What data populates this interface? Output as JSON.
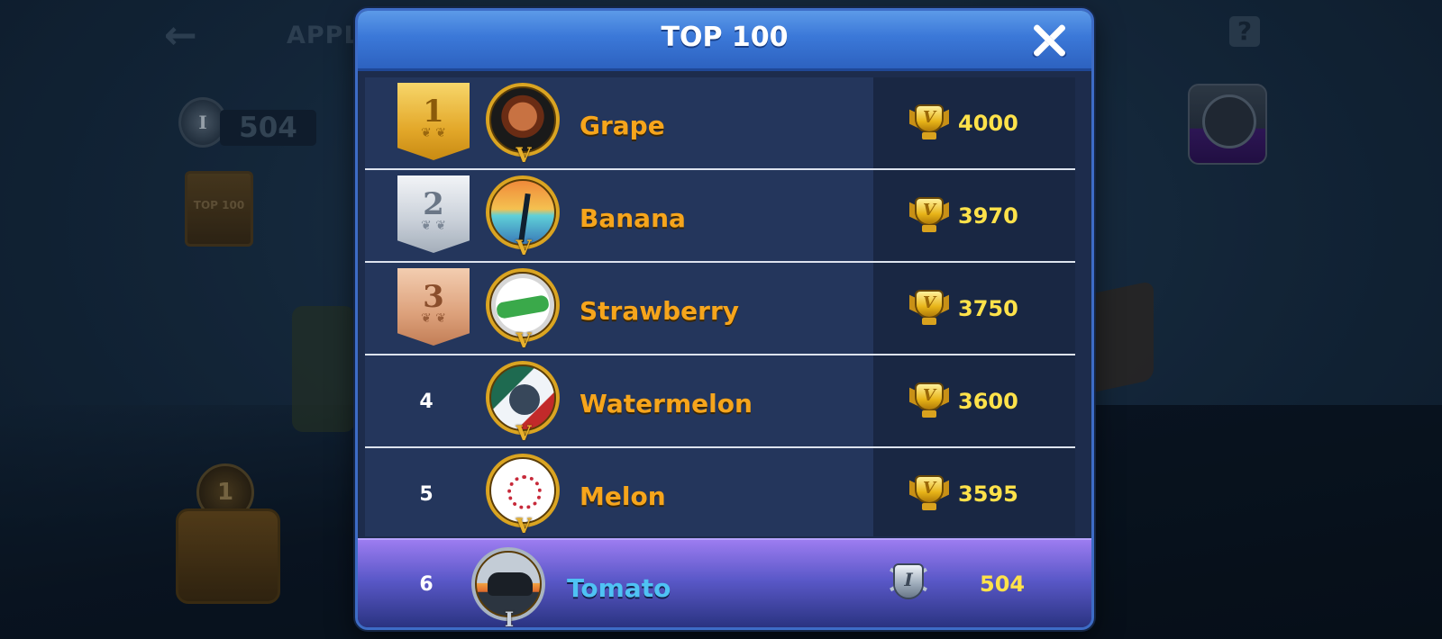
{
  "background": {
    "title": "APPL",
    "points": "504",
    "top100_badge": "TOP 100"
  },
  "dialog": {
    "title": "TOP 100",
    "close_icon": "close-icon"
  },
  "leaderboard": [
    {
      "rank": "1",
      "medal": "gold",
      "name": "Grape",
      "avatar_icon": "bulldog-emblem-icon",
      "score": "4000"
    },
    {
      "rank": "2",
      "medal": "silver",
      "name": "Banana",
      "avatar_icon": "palm-tree-emblem-icon",
      "score": "3970"
    },
    {
      "rank": "3",
      "medal": "bronze",
      "name": "Strawberry",
      "avatar_icon": "alligator-emblem-icon",
      "score": "3750"
    },
    {
      "rank": "4",
      "medal": "",
      "name": "Watermelon",
      "avatar_icon": "wolf-emblem-icon",
      "score": "3600"
    },
    {
      "rank": "5",
      "medal": "",
      "name": "Melon",
      "avatar_icon": "plum-blossom-flag-icon",
      "score": "3595"
    }
  ],
  "my_entry": {
    "rank": "6",
    "name": "Tomato",
    "avatar_icon": "bear-emblem-icon",
    "score": "504"
  },
  "colors": {
    "header_blue": "#3b78d8",
    "name_orange": "#f6a51c",
    "score_yellow": "#ffe24a",
    "my_name_blue": "#4fc2f4",
    "my_row_purple": "#7a68e0"
  }
}
